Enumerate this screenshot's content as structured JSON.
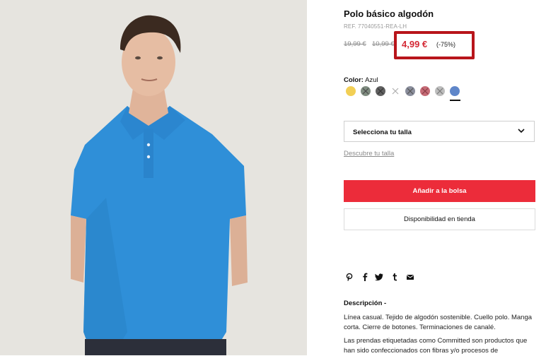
{
  "product": {
    "title": "Polo básico algodón",
    "ref": "REF. 77040551-REA-LH",
    "old_price_1": "19,99 €",
    "old_price_2": "10,99 €",
    "price": "4,99 €",
    "discount": "(-75%)"
  },
  "color": {
    "label": "Color:",
    "value": "Azul",
    "swatches": [
      {
        "name": "yellow",
        "hex": "#f2cf55",
        "available": true
      },
      {
        "name": "green-grey",
        "hex": "#7f8c80",
        "available": false
      },
      {
        "name": "dark-grey",
        "hex": "#606060",
        "available": false
      },
      {
        "name": "white",
        "hex": "#ffffff",
        "available": false
      },
      {
        "name": "slate",
        "hex": "#8a8e9c",
        "available": false
      },
      {
        "name": "pink",
        "hex": "#c56b76",
        "available": false
      },
      {
        "name": "light-grey",
        "hex": "#bdbdbd",
        "available": false
      },
      {
        "name": "blue",
        "hex": "#5f86c9",
        "available": true,
        "selected": true
      }
    ]
  },
  "size": {
    "select_label": "Selecciona tu talla",
    "guide_link": "Descubre tu talla"
  },
  "actions": {
    "add_to_bag": "Añadir a la bolsa",
    "store_availability": "Disponibilidad en tienda",
    "accent": "#ec2c3a"
  },
  "share_icons": [
    "pinterest-icon",
    "facebook-icon",
    "twitter-icon",
    "tumblr-icon",
    "email-icon"
  ],
  "description": {
    "title": "Descripción",
    "text1": "Línea casual. Tejido de algodón sostenible. Cuello polo. Manga corta. Cierre de botones. Terminaciones de canalé.",
    "text2": "Las prendas etiquetadas como Committed son productos que han sido confeccionados con fibras y/o procesos de"
  }
}
